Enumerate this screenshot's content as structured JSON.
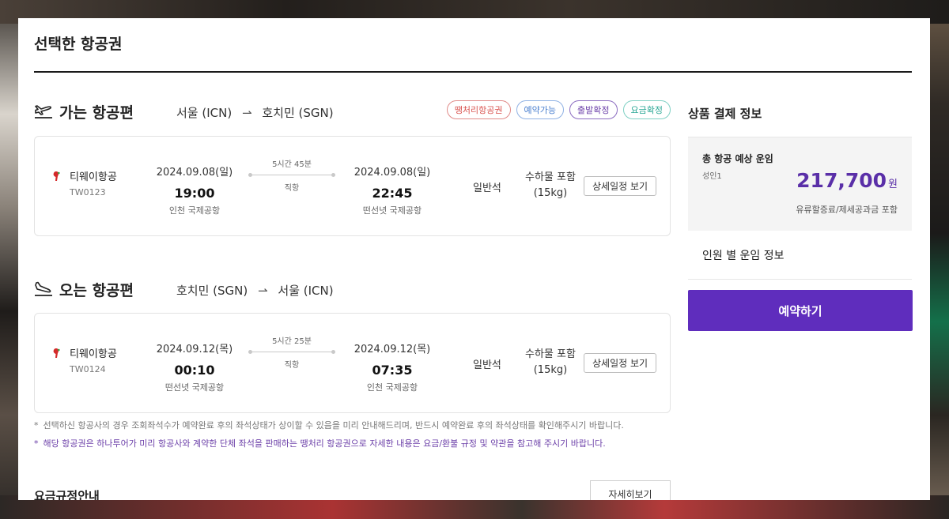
{
  "page_title": "선택한 항공권",
  "outbound": {
    "title": "가는 항공편",
    "origin": "서울 (ICN)",
    "destination": "호치민 (SGN)",
    "badges": [
      "땡처리항공권",
      "예약가능",
      "출발확정",
      "요금확정"
    ],
    "airline": "티웨이항공",
    "flight_no": "TW0123",
    "dep_date": "2024.09.08(일)",
    "dep_time": "19:00",
    "dep_airport": "인천 국제공항",
    "duration": "5시간 45분",
    "type": "직항",
    "arr_date": "2024.09.08(일)",
    "arr_time": "22:45",
    "arr_airport": "떤선녓 국제공항",
    "seat_class": "일반석",
    "baggage_1": "수하물 포함",
    "baggage_2": "(15kg)",
    "detail_btn": "상세일정 보기"
  },
  "inbound": {
    "title": "오는 항공편",
    "origin": "호치민 (SGN)",
    "destination": "서울 (ICN)",
    "airline": "티웨이항공",
    "flight_no": "TW0124",
    "dep_date": "2024.09.12(목)",
    "dep_time": "00:10",
    "dep_airport": "떤선녓 국제공항",
    "duration": "5시간 25분",
    "type": "직항",
    "arr_date": "2024.09.12(목)",
    "arr_time": "07:35",
    "arr_airport": "인천 국제공항",
    "seat_class": "일반석",
    "baggage_1": "수하물 포함",
    "baggage_2": "(15kg)",
    "detail_btn": "상세일정 보기"
  },
  "notes": {
    "star": "*",
    "note1": "선택하신 항공사의 경우 조회좌석수가 예약완료 후의 좌석상태가 상이할 수 있음을 미리 안내해드리며, 반드시 예약완료 후의 좌석상태를 확인해주시기 바랍니다.",
    "note2": "해당 항공권은 하나투어가 미리 항공사와 계약한 단체 좌석을 판매하는 땡처리 항공권으로 자세한 내용은 요금/환불 규정 및 약관을 참고해 주시기 바랍니다."
  },
  "fare_rules": {
    "title": "요금규정안내",
    "button": "자세히보기"
  },
  "payment": {
    "title": "상품 결제 정보",
    "total_label": "총 항공 예상 운임",
    "pax": "성인1",
    "price": "217,700",
    "currency": "원",
    "included": "유류할증료/제세공과금 포함",
    "per_pax": "인원 별 운임 정보",
    "reserve_btn": "예약하기"
  },
  "colors": {
    "accent": "#5f2dbd",
    "badge_red": "#d9534f",
    "badge_blue": "#4a7fcf",
    "badge_purple": "#6b3fa8",
    "badge_teal": "#2aa795"
  }
}
